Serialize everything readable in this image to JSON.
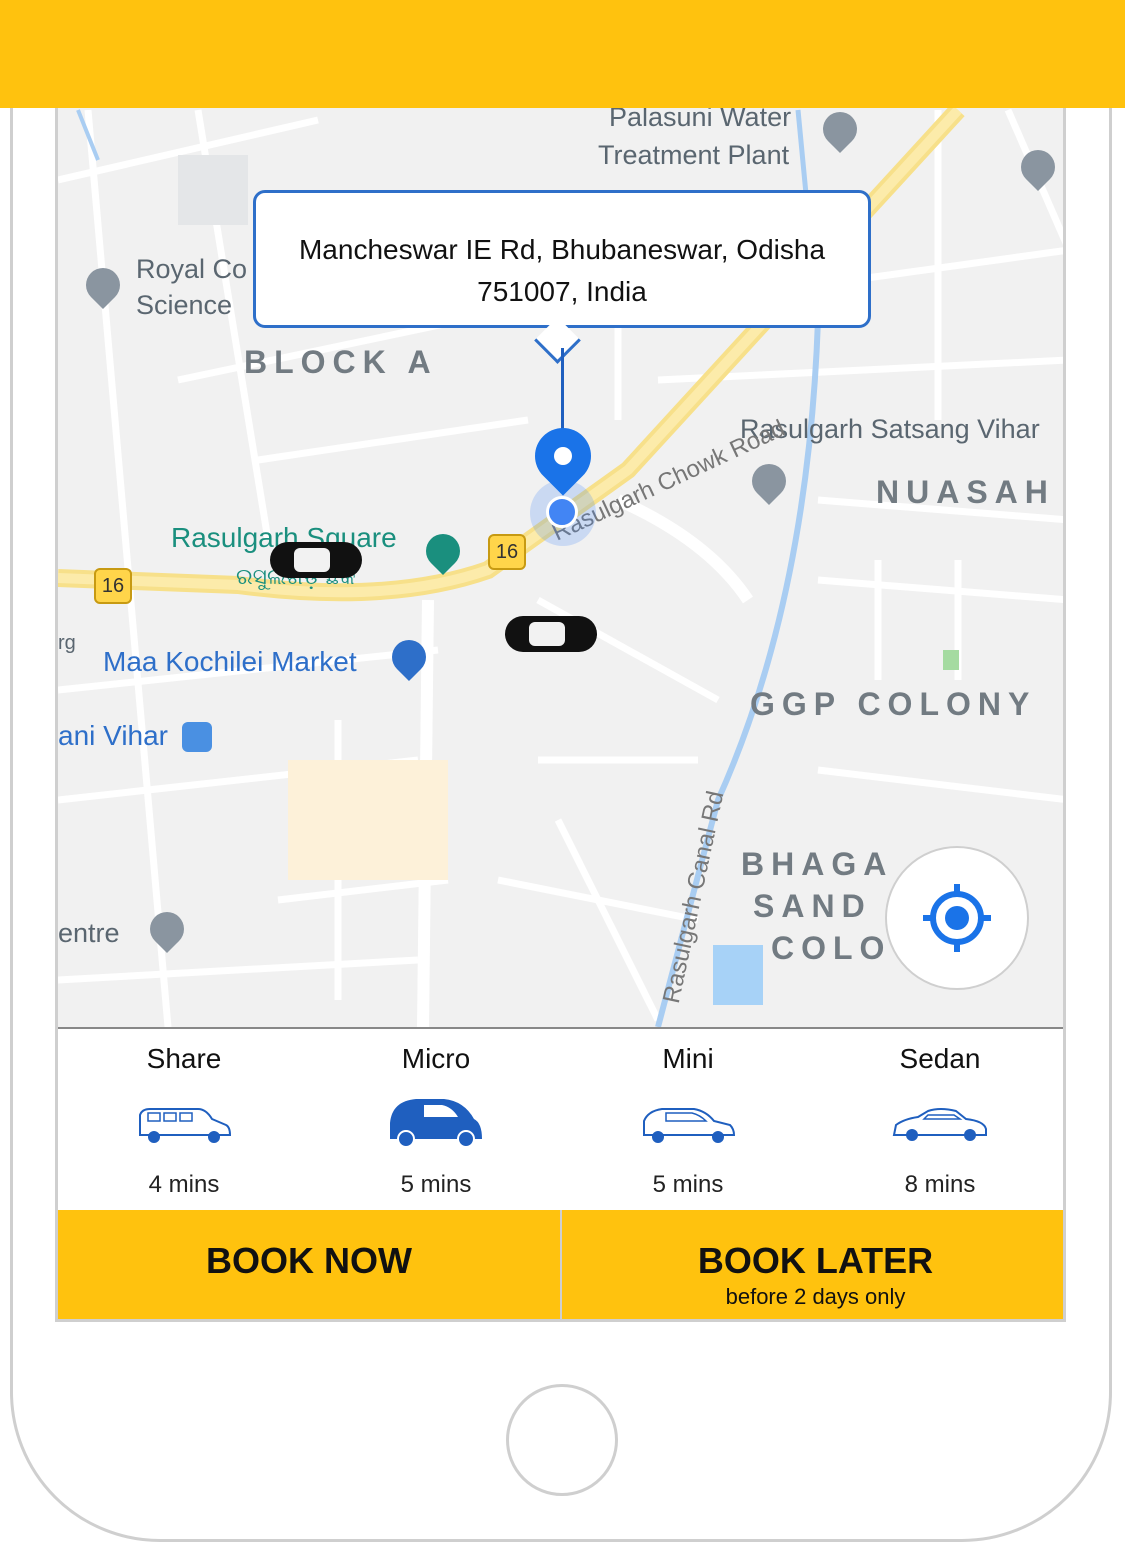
{
  "app": {
    "accent_color": "#ffc20e",
    "selected_color": "#1f5fbf"
  },
  "map": {
    "labels": {
      "palasuni_1": "Palasuni Water",
      "palasuni_2": "Treatment Plant",
      "royal_1": "Royal Co",
      "royal_2": "Science",
      "block_a": "BLOCK A",
      "satsang": "Rasulgarh Satsang Vihar",
      "nuasahi": "NUASAH",
      "rasulgarh_square": "Rasulgarh Square",
      "rasulgarh_square_odia": "ରସୁଲଗଡ଼ ଛକ",
      "chowk_road": "Rasulgarh Chowk Road",
      "maa_kochilei": "Maa Kochilei Market",
      "ani_vihar": "ani Vihar",
      "ggp_colony": "GGP COLONY",
      "canal_rd": "Rasulgarh Canal Rd",
      "bhagabati_1": "BHAGA",
      "bhagabati_2": "SAND",
      "bhagabati_3": "COLO",
      "centre": "entre",
      "rg": "rg",
      "highway_shield_1": "16",
      "highway_shield_2": "16"
    },
    "icons": [
      "temple-icon",
      "university-icon",
      "om-icon",
      "park-icon",
      "shopping-icon",
      "bus-icon",
      "place-icon"
    ]
  },
  "pickup": {
    "address_line1": "Mancheswar IE Rd, Bhubaneswar, Odisha",
    "address_line2": "751007, India"
  },
  "vehicles": [
    {
      "name": "Share",
      "eta": "4 mins",
      "icon": "van-icon",
      "selected": false
    },
    {
      "name": "Micro",
      "eta": "5 mins",
      "icon": "micro-car-icon",
      "selected": true
    },
    {
      "name": "Mini",
      "eta": "5 mins",
      "icon": "hatchback-icon",
      "selected": false
    },
    {
      "name": "Sedan",
      "eta": "8 mins",
      "icon": "sedan-icon",
      "selected": false
    }
  ],
  "booking": {
    "book_now": "BOOK NOW",
    "book_later": "BOOK LATER",
    "book_later_note": "before 2 days only"
  }
}
